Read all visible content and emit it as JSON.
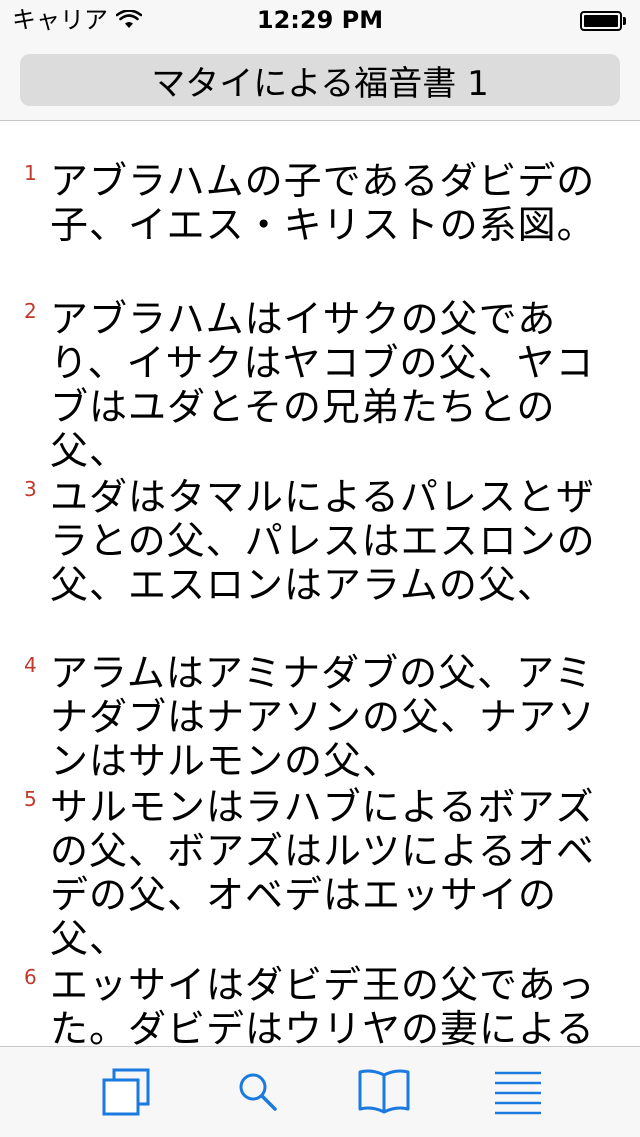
{
  "status": {
    "carrier": "キャリア",
    "time": "12:29 PM",
    "battery_level": 1.0
  },
  "header": {
    "title": "マタイによる福音書 1"
  },
  "verses": [
    {
      "num": "1",
      "text": "アブラハムの子であるダビデの子、イエス・キリストの系図。"
    },
    {
      "num": "2",
      "text": "アブラハムはイサクの父であり、イサクはヤコブの父、ヤコブはユダとその兄弟たちとの父、"
    },
    {
      "num": "3",
      "text": "ユダはタマルによるパレスとザラとの父、パレスはエスロンの父、エスロンはアラムの父、"
    },
    {
      "num": "4",
      "text": "アラムはアミナダブの父、アミナダブはナアソンの父、ナアソンはサルモンの父、"
    },
    {
      "num": "5",
      "text": "サルモンはラハブによるボアズの父、ボアズはルツによるオベデの父、オベデはエッサイの父、"
    },
    {
      "num": "6",
      "text": "エッサイはダビデ王の父であった。ダビデはウリヤの妻によるソロモンの父であり、"
    }
  ],
  "tabs": [
    {
      "icon": "copy-icon"
    },
    {
      "icon": "search-icon"
    },
    {
      "icon": "book-icon"
    },
    {
      "icon": "list-icon"
    }
  ],
  "colors": {
    "accent": "#1a7adf",
    "verse_number": "#c0392b"
  }
}
